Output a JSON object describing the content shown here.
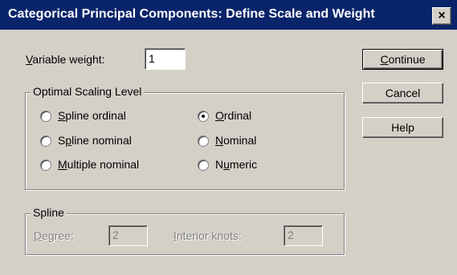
{
  "window": {
    "title": "Categorical Principal Components: Define Scale and Weight",
    "close_glyph": "×"
  },
  "variable_weight": {
    "label": "Variable weight:",
    "mnemonic": "V",
    "label_rest": "ariable weight:",
    "value": "1"
  },
  "optimal_scaling": {
    "title": "Optimal Scaling Level",
    "options": [
      {
        "pre": "",
        "mn": "S",
        "post": "pline ordinal",
        "checked": false
      },
      {
        "pre": "S",
        "mn": "p",
        "post": "line nominal",
        "checked": false
      },
      {
        "pre": "",
        "mn": "M",
        "post": "ultiple nominal",
        "checked": false
      },
      {
        "pre": "",
        "mn": "O",
        "post": "rdinal",
        "checked": true
      },
      {
        "pre": "",
        "mn": "N",
        "post": "ominal",
        "checked": false
      },
      {
        "pre": "N",
        "mn": "u",
        "post": "meric",
        "checked": false
      }
    ]
  },
  "spline": {
    "title": "Spline",
    "degree": {
      "mn": "D",
      "post": "egree:",
      "value": "2"
    },
    "interior_knots": {
      "mn": "I",
      "post": "nterior knots:",
      "value": "2"
    }
  },
  "buttons": {
    "continue": {
      "mn": "C",
      "post": "ontinue"
    },
    "cancel": {
      "label": "Cancel"
    },
    "help": {
      "label": "Help"
    }
  }
}
